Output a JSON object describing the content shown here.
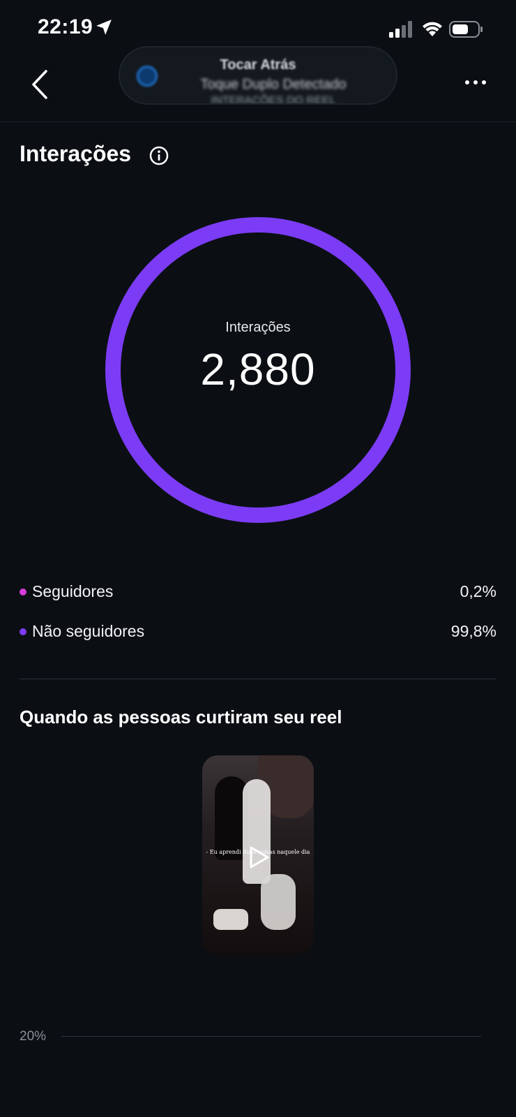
{
  "status_bar": {
    "time": "22:19"
  },
  "notification": {
    "title": "Tocar Atrás",
    "subtitle": "Toque Duplo Detectado",
    "extra": "INTERAÇÕES DO REEL"
  },
  "section": {
    "title": "Interações"
  },
  "donut": {
    "label": "Interações",
    "value": "2,880",
    "ring_color": "#7c3cf5"
  },
  "legend": [
    {
      "name": "Seguidores",
      "value": "0,2%",
      "color": "#d63cd9"
    },
    {
      "name": "Não seguidores",
      "value": "99,8%",
      "color": "#7c3cf5"
    }
  ],
  "reel": {
    "title": "Quando as pessoas curtiram seu reel",
    "caption": "- Eu aprendi duas coisas naquele dia"
  },
  "chart_axis": {
    "tick": "20%"
  }
}
